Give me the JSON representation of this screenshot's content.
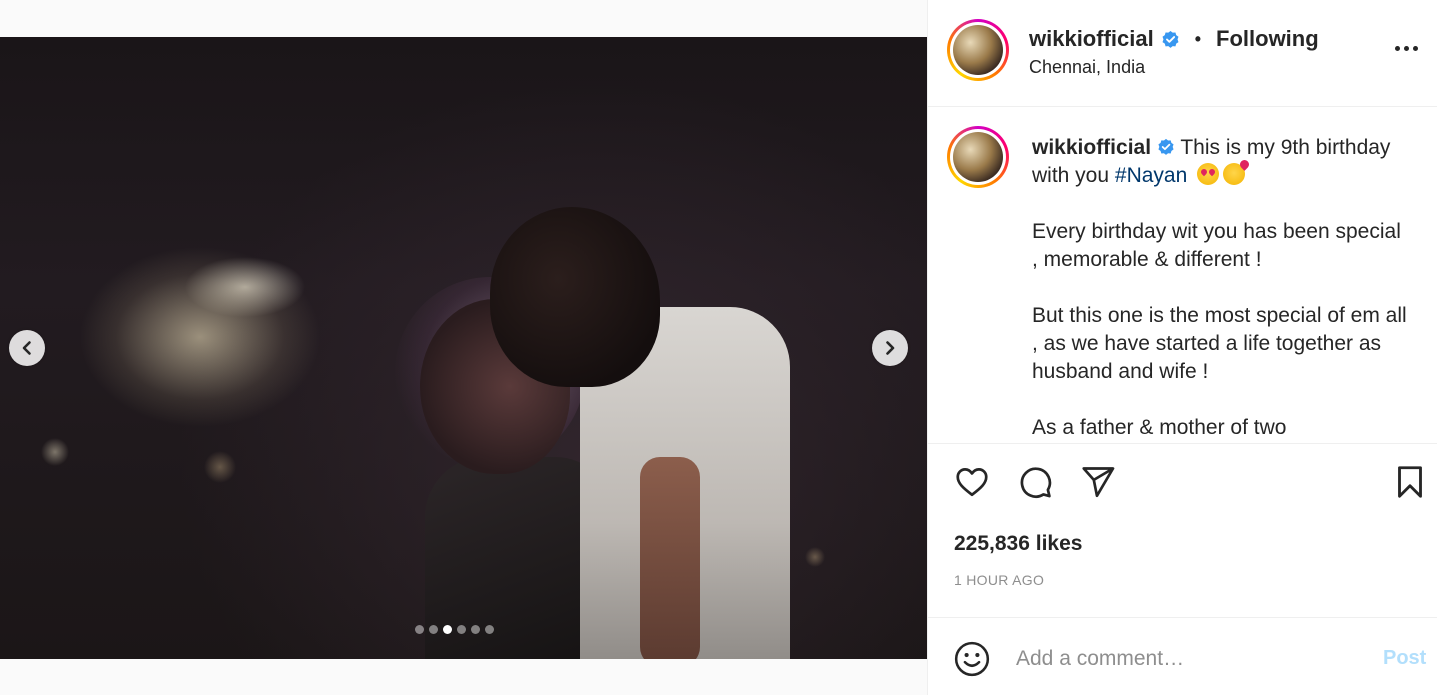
{
  "post": {
    "username": "wikkiofficial",
    "follow_status": "Following",
    "location": "Chennai, India",
    "caption": {
      "username": "wikkiofficial",
      "line1": "This is my 9th birthday with you",
      "hashtag": "#Nayan",
      "para2": "Every birthday wit you has been special , memorable & different !",
      "para3": "But this one is the most special of em all , as we have started a life together as husband and wife !",
      "para4": "As a father & mother of two"
    },
    "likes": "225,836 likes",
    "time_ago": "1 HOUR AGO"
  },
  "carousel": {
    "total": 6,
    "active_index": 2
  },
  "comment": {
    "placeholder": "Add a comment…",
    "post_label": "Post"
  },
  "icons": {
    "verified": "verified-badge-icon",
    "more": "more-options-icon",
    "like": "heart-icon",
    "comment": "comment-bubble-icon",
    "share": "paper-plane-icon",
    "save": "bookmark-icon",
    "emoji": "smiley-face-icon",
    "prev": "chevron-left-icon",
    "next": "chevron-right-icon"
  },
  "colors": {
    "verified_blue": "#3897f0",
    "hashtag": "#00376b",
    "post_disabled": "#b2dffc",
    "muted": "#8e8e8e"
  }
}
